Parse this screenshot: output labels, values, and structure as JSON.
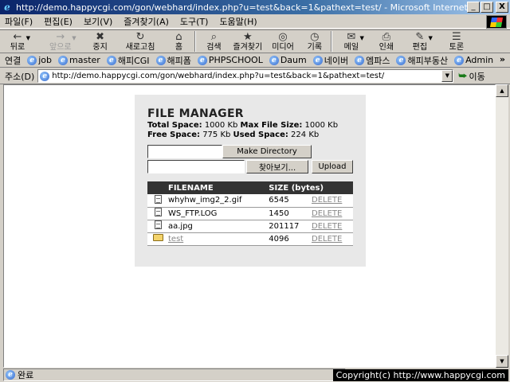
{
  "window": {
    "title": "http://demo.happycgi.com/gon/webhard/index.php?u=test&back=1&pathext=test/ - Microsoft Internet Explorer",
    "buttons": {
      "minimize": "_",
      "maximize": "□",
      "close": "X"
    }
  },
  "menubar": [
    "파일(F)",
    "편집(E)",
    "보기(V)",
    "즐겨찾기(A)",
    "도구(T)",
    "도움말(H)"
  ],
  "toolbar": {
    "back": "뒤로",
    "forward": "앞으로",
    "stop": "중지",
    "refresh": "새로고침",
    "home": "홈",
    "search": "검색",
    "favorites": "즐겨찾기",
    "media": "미디어",
    "history": "기록",
    "mail": "메일",
    "print": "인쇄",
    "edit": "편집",
    "discuss": "토론"
  },
  "links": {
    "label": "연결",
    "items": [
      "job",
      "master",
      "해피CGI",
      "해피폼",
      "PHPSCHOOL",
      "Daum",
      "네이버",
      "엠파스",
      "해피부동산",
      "Admin"
    ],
    "more": "»"
  },
  "address": {
    "label": "주소(D)",
    "url": "http://demo.happycgi.com/gon/webhard/index.php?u=test&back=1&pathext=test/",
    "go": "이동"
  },
  "file_manager": {
    "title": "FILE MANAGER",
    "total_space_label": "Total Space:",
    "total_space": "1000 Kb",
    "max_file_label": "Max File Size:",
    "max_file": "1000 Kb",
    "free_space_label": "Free Space:",
    "free_space": "775 Kb",
    "used_space_label": "Used Space:",
    "used_space": "224 Kb",
    "make_directory": "Make Directory",
    "browse": "찾아보기...",
    "upload": "Upload",
    "columns": {
      "name": "FILENAME",
      "size": "SIZE (bytes)"
    },
    "files": [
      {
        "type": "file",
        "name": "whyhw_img2_2.gif",
        "size": "6545",
        "action": "DELETE"
      },
      {
        "type": "file",
        "name": "WS_FTP.LOG",
        "size": "1450",
        "action": "DELETE"
      },
      {
        "type": "file",
        "name": "aa.jpg",
        "size": "201117",
        "action": "DELETE"
      },
      {
        "type": "folder",
        "name": "test",
        "size": "4096",
        "action": "DELETE"
      }
    ]
  },
  "status": {
    "text": "완료",
    "copyright": "Copyright(c) http://www.happycgi.com"
  }
}
